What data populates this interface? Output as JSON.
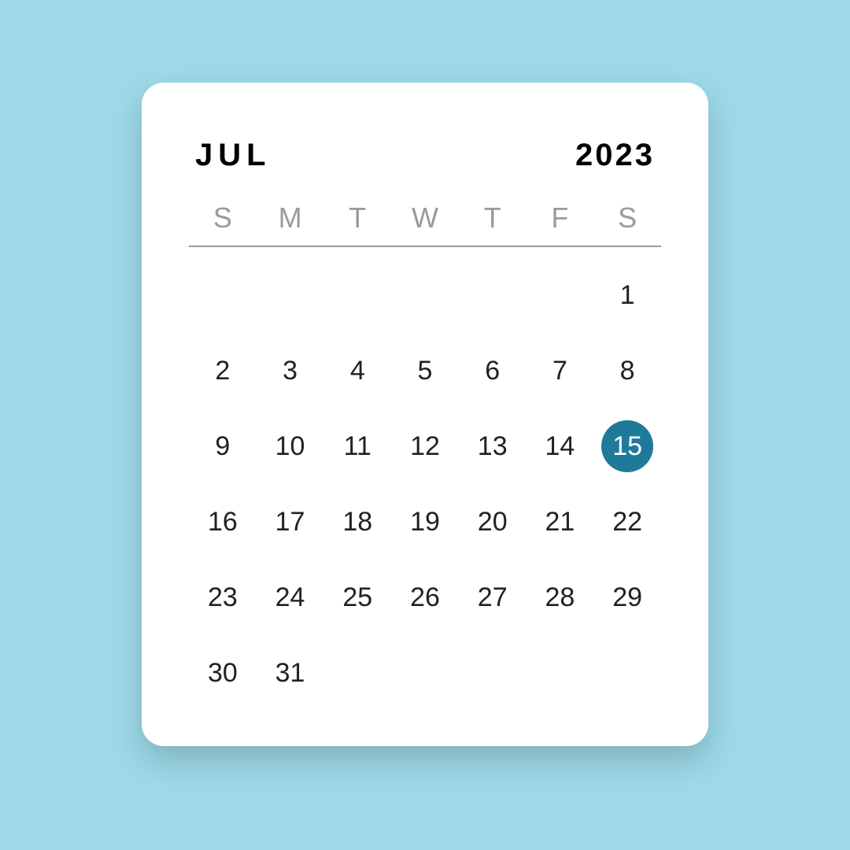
{
  "header": {
    "month": "JUL",
    "year": "2023"
  },
  "weekdays": [
    "S",
    "M",
    "T",
    "W",
    "T",
    "F",
    "S"
  ],
  "firstDayOffset": 6,
  "daysInMonth": 31,
  "selectedDay": 15,
  "colors": {
    "background": "#9dd9e8",
    "selected": "#1f7a99"
  }
}
